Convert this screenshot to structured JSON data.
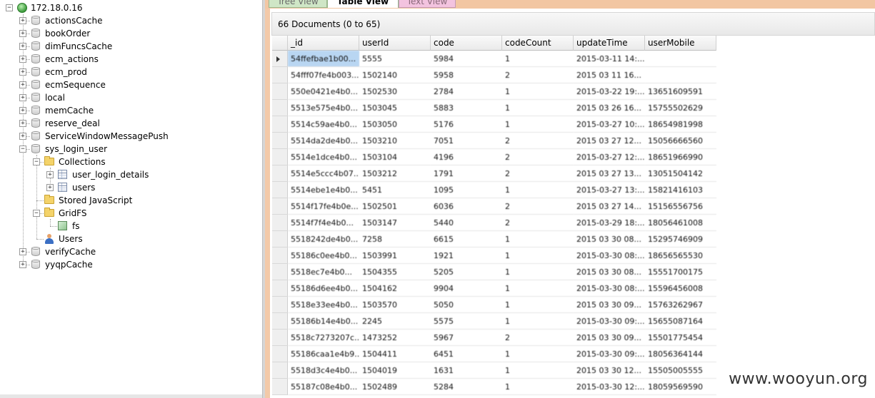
{
  "tree": {
    "server": "172.18.0.16",
    "databases": [
      "actionsCache",
      "bookOrder",
      "dimFuncsCache",
      "ecm_actions",
      "ecm_prod",
      "ecmSequence",
      "local",
      "memCache",
      "reserve_deal",
      "ServiceWindowMessagePush",
      "sys_login_user"
    ],
    "expanded_db": {
      "collections_label": "Collections",
      "collections": [
        "user_login_details",
        "users"
      ],
      "stored_js_label": "Stored JavaScript",
      "gridfs_label": "GridFS",
      "gridfs_items": [
        "fs"
      ],
      "users_label": "Users"
    },
    "after_databases": [
      "verifyCache",
      "yyqpCache"
    ]
  },
  "tabs": [
    "Tree View",
    "Table View",
    "Text View"
  ],
  "active_tab": "Table View",
  "doc_summary": "66 Documents (0 to 65)",
  "columns": [
    "_id",
    "userId",
    "code",
    "codeCount",
    "updateTime",
    "userMobile"
  ],
  "rows": [
    [
      "54ffefbae1b00...",
      "5555",
      "5984",
      "1",
      "2015-03-11 14:...",
      ""
    ],
    [
      "54fff07fe4b003...",
      "1502140",
      "5958",
      "2",
      "2015 03 11 16...",
      ""
    ],
    [
      "550e0421e4b0...",
      "1502530",
      "2784",
      "1",
      "2015-03-22 19:...",
      "13651609591"
    ],
    [
      "5513e575e4b0...",
      "1503045",
      "5883",
      "1",
      "2015 03 26 16...",
      "15755502629"
    ],
    [
      "5514c59ae4b0...",
      "1503050",
      "5176",
      "1",
      "2015-03-27 10:...",
      "18654981998"
    ],
    [
      "5514da2de4b0...",
      "1503210",
      "7051",
      "2",
      "2015 03 27 12...",
      "15056666560"
    ],
    [
      "5514e1dce4b0...",
      "1503104",
      "4196",
      "2",
      "2015-03-27 12:...",
      "18651966990"
    ],
    [
      "5514e5ccc4b07...",
      "1503212",
      "1791",
      "2",
      "2015 03 27 13...",
      "13051504142"
    ],
    [
      "5514ebe1e4b0...",
      "5451",
      "1095",
      "1",
      "2015-03-27 13:...",
      "15821416103"
    ],
    [
      "5514f17fe4b0e...",
      "1502501",
      "6036",
      "2",
      "2015 03 27 14...",
      "15156556756"
    ],
    [
      "5514f7f4e4b0...",
      "1503147",
      "5440",
      "2",
      "2015-03-29 18:...",
      "18056461008"
    ],
    [
      "5518242de4b0...",
      "7258",
      "6615",
      "1",
      "2015 03 30 08...",
      "15295746909"
    ],
    [
      "55186c0ee4b0...",
      "1503991",
      "1921",
      "1",
      "2015-03-30 08:...",
      "18656565530"
    ],
    [
      "5518ec7e4b0...",
      "1504355",
      "5205",
      "1",
      "2015 03 30 08...",
      "15551700175"
    ],
    [
      "55186d6ee4b0...",
      "1504162",
      "9904",
      "1",
      "2015-03-30 08:...",
      "15596456008"
    ],
    [
      "5518e33ee4b0...",
      "1503570",
      "5050",
      "1",
      "2015 03 30 09...",
      "15763262967"
    ],
    [
      "55186b14e4b0...",
      "2245",
      "5575",
      "1",
      "2015-03-30 09:...",
      "15655087164"
    ],
    [
      "5518c7273207c...",
      "1473252",
      "5967",
      "2",
      "2015 03 30 09...",
      "15501775454"
    ],
    [
      "55186caa1e4b9...",
      "1504411",
      "6451",
      "1",
      "2015-03-30 09:...",
      "18056364144"
    ],
    [
      "5518d3c4e4b0...",
      "1504019",
      "1631",
      "1",
      "2015 03 30 12...",
      "15505005555"
    ],
    [
      "55187c08e4b0...",
      "1502489",
      "5284",
      "1",
      "2015-03-30 12:...",
      "18059569590"
    ]
  ],
  "watermark": "www.wooyun.org"
}
